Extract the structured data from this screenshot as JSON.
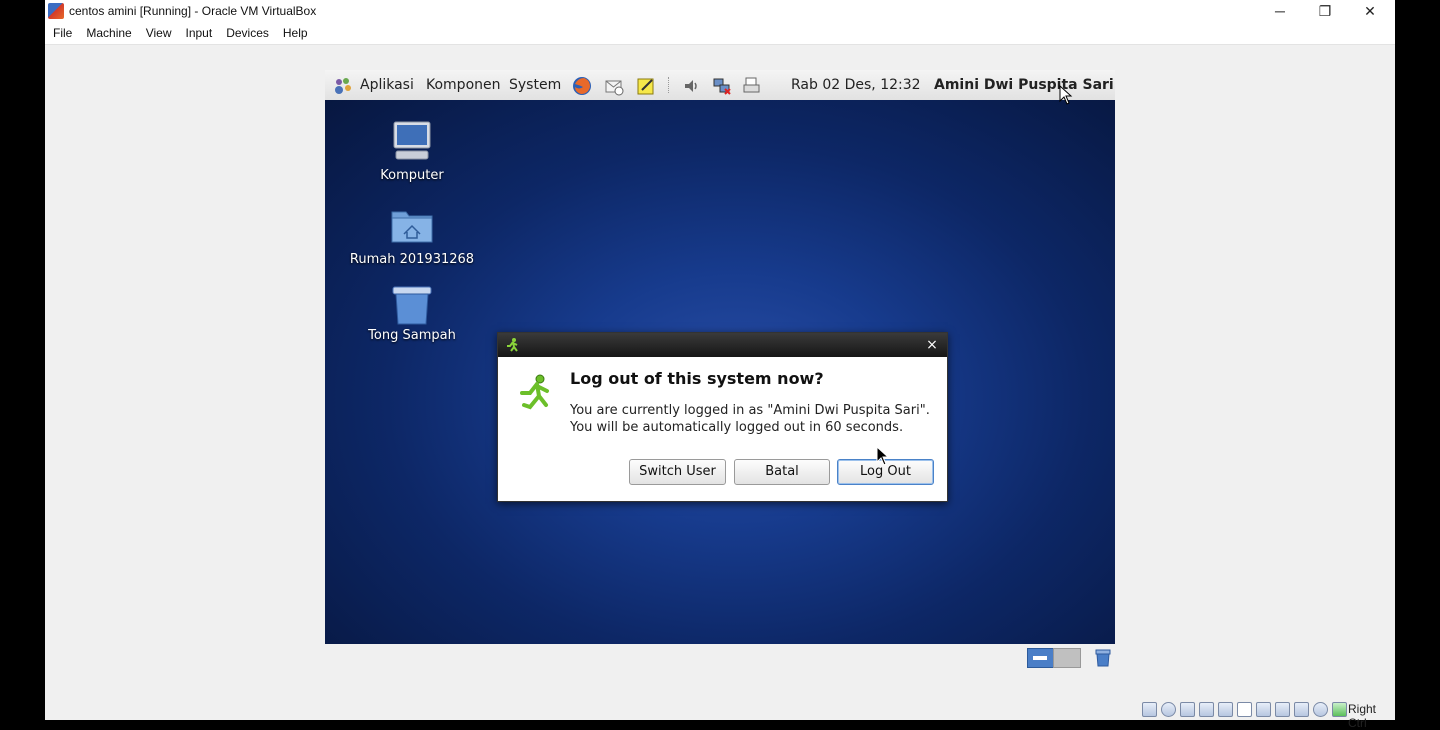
{
  "host": {
    "window_title": "centos amini [Running] - Oracle VM VirtualBox",
    "controls": {
      "minimize": "─",
      "maximize": "❐",
      "close": "✕"
    },
    "menu": [
      "File",
      "Machine",
      "View",
      "Input",
      "Devices",
      "Help"
    ],
    "host_key_label": "Right Ctrl"
  },
  "panel": {
    "menus": [
      "Aplikasi",
      "Komponen",
      "System"
    ],
    "launchers": [
      "firefox-icon",
      "mail-icon",
      "notes-icon",
      "volume-icon",
      "network-icon",
      "printer-icon"
    ],
    "clock": "Rab 02 Des, 12:32",
    "user": "Amini Dwi Puspita Sari"
  },
  "desktop": {
    "icons": [
      {
        "label": "Komputer",
        "icon": "computer-icon"
      },
      {
        "label": "Rumah 201931268",
        "icon": "home-folder-icon"
      },
      {
        "label": "Tong Sampah",
        "icon": "trash-icon"
      }
    ]
  },
  "dialog": {
    "heading": "Log out of this system now?",
    "line1": "You are currently logged in as \"Amini Dwi Puspita Sari\".",
    "line2": "You will be automatically logged out in 60 seconds.",
    "close": "×",
    "buttons": {
      "switch_user": "Switch User",
      "cancel": "Batal",
      "logout": "Log Out"
    }
  },
  "colors": {
    "accent": "#4a82c8",
    "desktop": "#173b8d",
    "panel": "#e8e8e8"
  }
}
